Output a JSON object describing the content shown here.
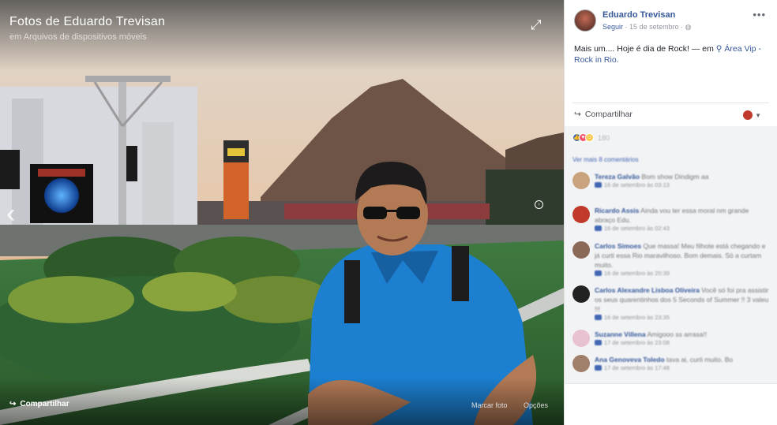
{
  "viewer": {
    "title": "Fotos de Eduardo Trevisan",
    "subtitle": "em Arquivos de dispositivos móveis",
    "share_label": "Compartilhar",
    "tag_label": "Marcar foto",
    "options_label": "Opções"
  },
  "post": {
    "author": "Eduardo Trevisan",
    "follow_label": "Seguir",
    "date": "15 de setembro",
    "text": "Mais um.... Hoje é dia de Rock!",
    "at_label": "— em",
    "location": "Área Vip - Rock in Rio.",
    "share_label": "Compartilhar"
  },
  "reactions": {
    "count": "180"
  },
  "comments_section": {
    "more_label": "Ver mais 8 comentários",
    "items": [
      {
        "author": "Tereza Galvão",
        "text": "Bom show Dindigm aa",
        "time": "16 de setembro às 03:13",
        "avatar_color": "#c9a27e"
      },
      {
        "author": "Ricardo Assis",
        "text": "Ainda vou ter essa moral nm grande abraço Edu.",
        "time": "16 de setembro às 02:43",
        "avatar_color": "#c0392b"
      },
      {
        "author": "Carlos Simoes",
        "text": "Que massa! Meu filhote está chegando e já curti essa Rio maravilhoso. Bom demais. Só a curtam muito.",
        "time": "16 de setembro às 20:39",
        "avatar_color": "#8a6a56"
      },
      {
        "author": "Carlos Alexandre Lisboa Oliveira",
        "text": "Você só foi pra assistir os seus quarentinhos dos 5 Seconds of Summer !! 3 valeu !!!",
        "time": "16 de setembro às 23:35",
        "avatar_color": "#222222"
      },
      {
        "author": "Suzanne Villena",
        "text": "Amigooo ss arrasa!!",
        "time": "17 de setembro às 23:08",
        "avatar_color": "#e8c1d2"
      },
      {
        "author": "Ana Genoveva Toledo",
        "text": "tava ai, curti muito. Bo",
        "time": "17 de setembro às 17:48",
        "avatar_color": "#a0806a"
      }
    ]
  },
  "colors": {
    "link": "#365899",
    "accent": "#4267b2",
    "panel_bg": "#f2f3f5"
  }
}
